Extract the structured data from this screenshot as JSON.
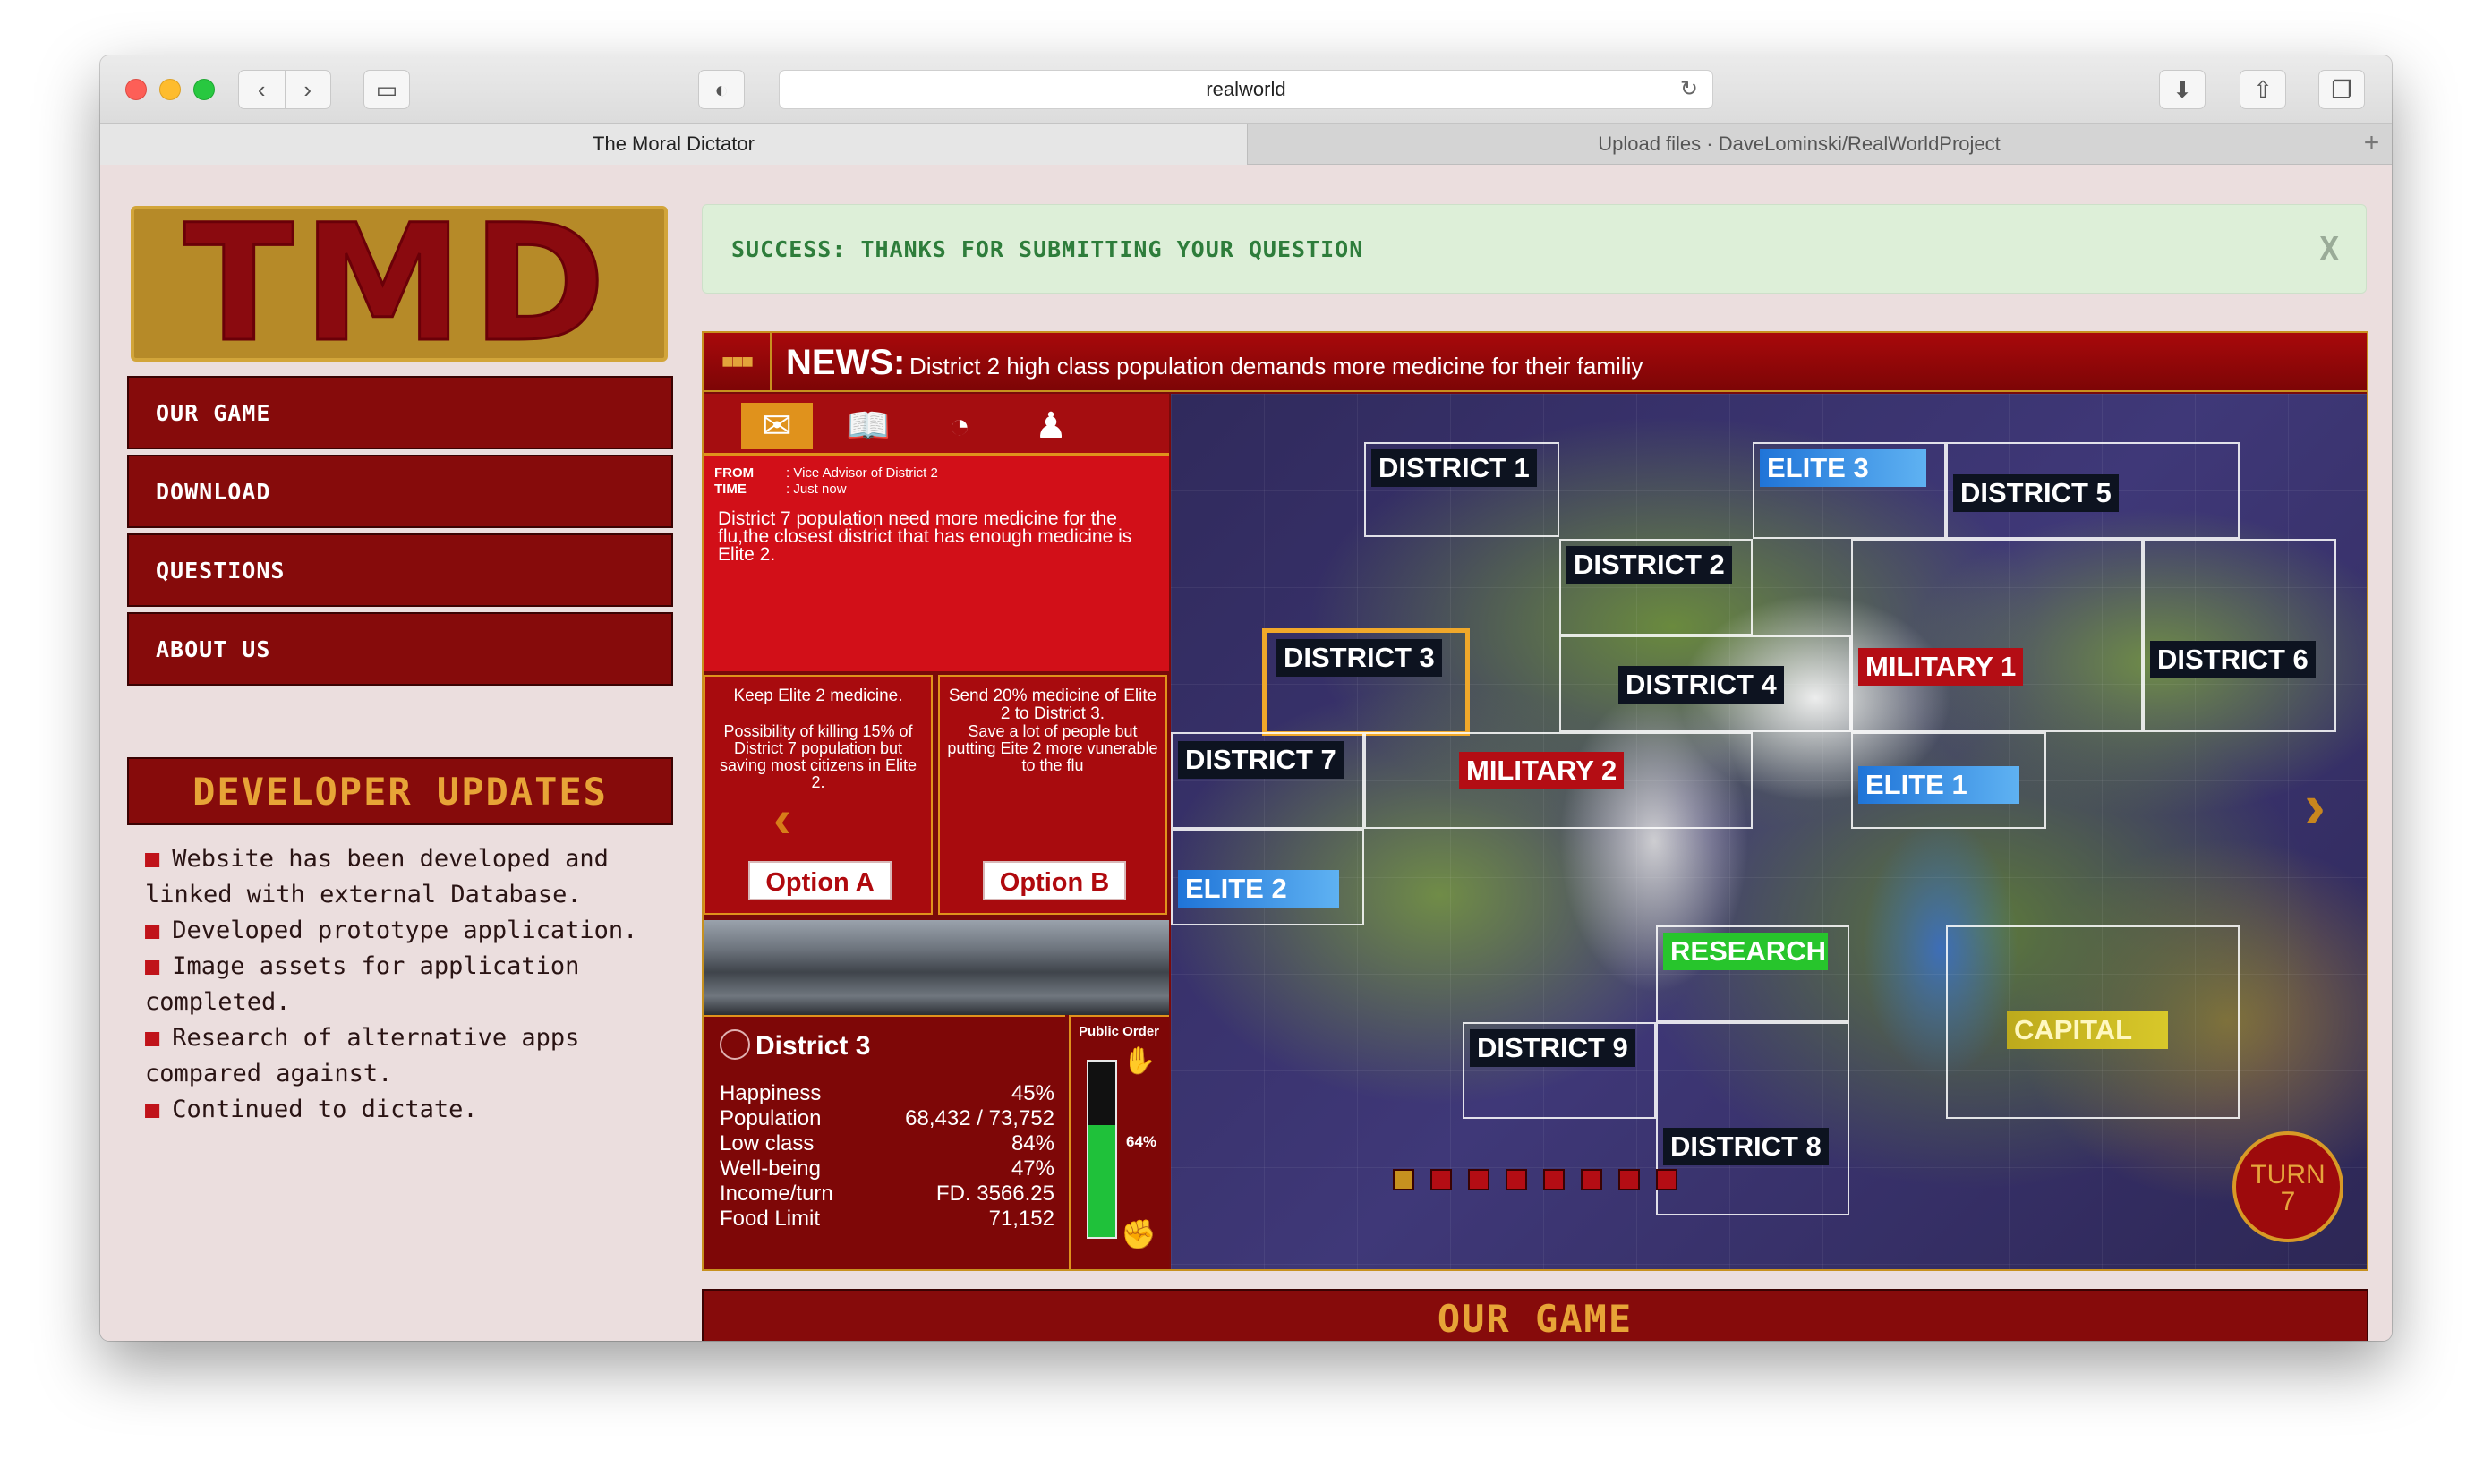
{
  "browser": {
    "url": "realworld",
    "tabs": [
      {
        "label": "The Moral Dictator",
        "active": true
      },
      {
        "label": "Upload files · DaveLominski/RealWorldProject",
        "active": false
      }
    ],
    "new_tab": "+"
  },
  "sidebar": {
    "logo_text": "TMD",
    "menu": [
      {
        "label": "OUR GAME"
      },
      {
        "label": "DOWNLOAD"
      },
      {
        "label": "QUESTIONS"
      },
      {
        "label": "ABOUT US"
      }
    ],
    "updates_title": "DEVELOPER UPDATES",
    "updates": [
      "Website has been developed and linked with external Database.",
      "Developed prototype application.",
      "Image assets for application completed.",
      "Research of alternative apps compared against.",
      "Continued to dictate."
    ]
  },
  "alert": {
    "text": "SUCCESS: THANKS FOR SUBMITTING YOUR QUESTION",
    "close": "X"
  },
  "game": {
    "news_label": "NEWS:",
    "news_text": "District 2 high class population demands more medicine for their familiy",
    "message": {
      "from_label": "FROM",
      "from_value": ": Vice Advisor of District 2",
      "time_label": "TIME",
      "time_value": ": Just now",
      "body": "District 7 population need more medicine for the flu,the closest district that has enough medicine is Elite 2."
    },
    "options": [
      {
        "title": "Keep Elite 2 medicine.",
        "desc": "Possibility of killing 15% of District 7 population but saving most citizens in Elite 2.",
        "button": "Option A"
      },
      {
        "title": "Send 20% medicine of Elite 2 to District 3.",
        "desc": "Save a lot of people but putting Eite 2 more vunerable to the flu",
        "button": "Option B"
      }
    ],
    "district": {
      "name": "District 3",
      "stats": [
        {
          "label": "Happiness",
          "value": "45%"
        },
        {
          "label": "Population",
          "value": "68,432 / 73,752"
        },
        {
          "label": "Low class",
          "value": "84%"
        },
        {
          "label": "Well-being",
          "value": "47%"
        },
        {
          "label": "Income/turn",
          "value": "FD. 3566.25"
        },
        {
          "label": "Food Limit",
          "value": "71,152"
        }
      ]
    },
    "public_order": {
      "label": "Public Order",
      "value": 0.64,
      "text": "64%"
    },
    "map_labels": [
      "DISTRICT 1",
      "ELITE 3",
      "DISTRICT 5",
      "DISTRICT 2",
      "DISTRICT 3",
      "DISTRICT 4",
      "MILITARY 1",
      "DISTRICT 6",
      "DISTRICT 7",
      "MILITARY 2",
      "ELITE 1",
      "ELITE 2",
      "RESEARCH",
      "CAPITAL",
      "DISTRICT 9",
      "DISTRICT 8"
    ],
    "selected_district": "DISTRICT 3",
    "turn_label": "TURN",
    "turn_number": "7",
    "turn_pages": 8,
    "active_page": 1
  },
  "section_title": "OUR GAME",
  "colors": {
    "brand_red": "#860b0b",
    "accent_gold": "#e7a437",
    "success_green": "#2e7d3b"
  }
}
